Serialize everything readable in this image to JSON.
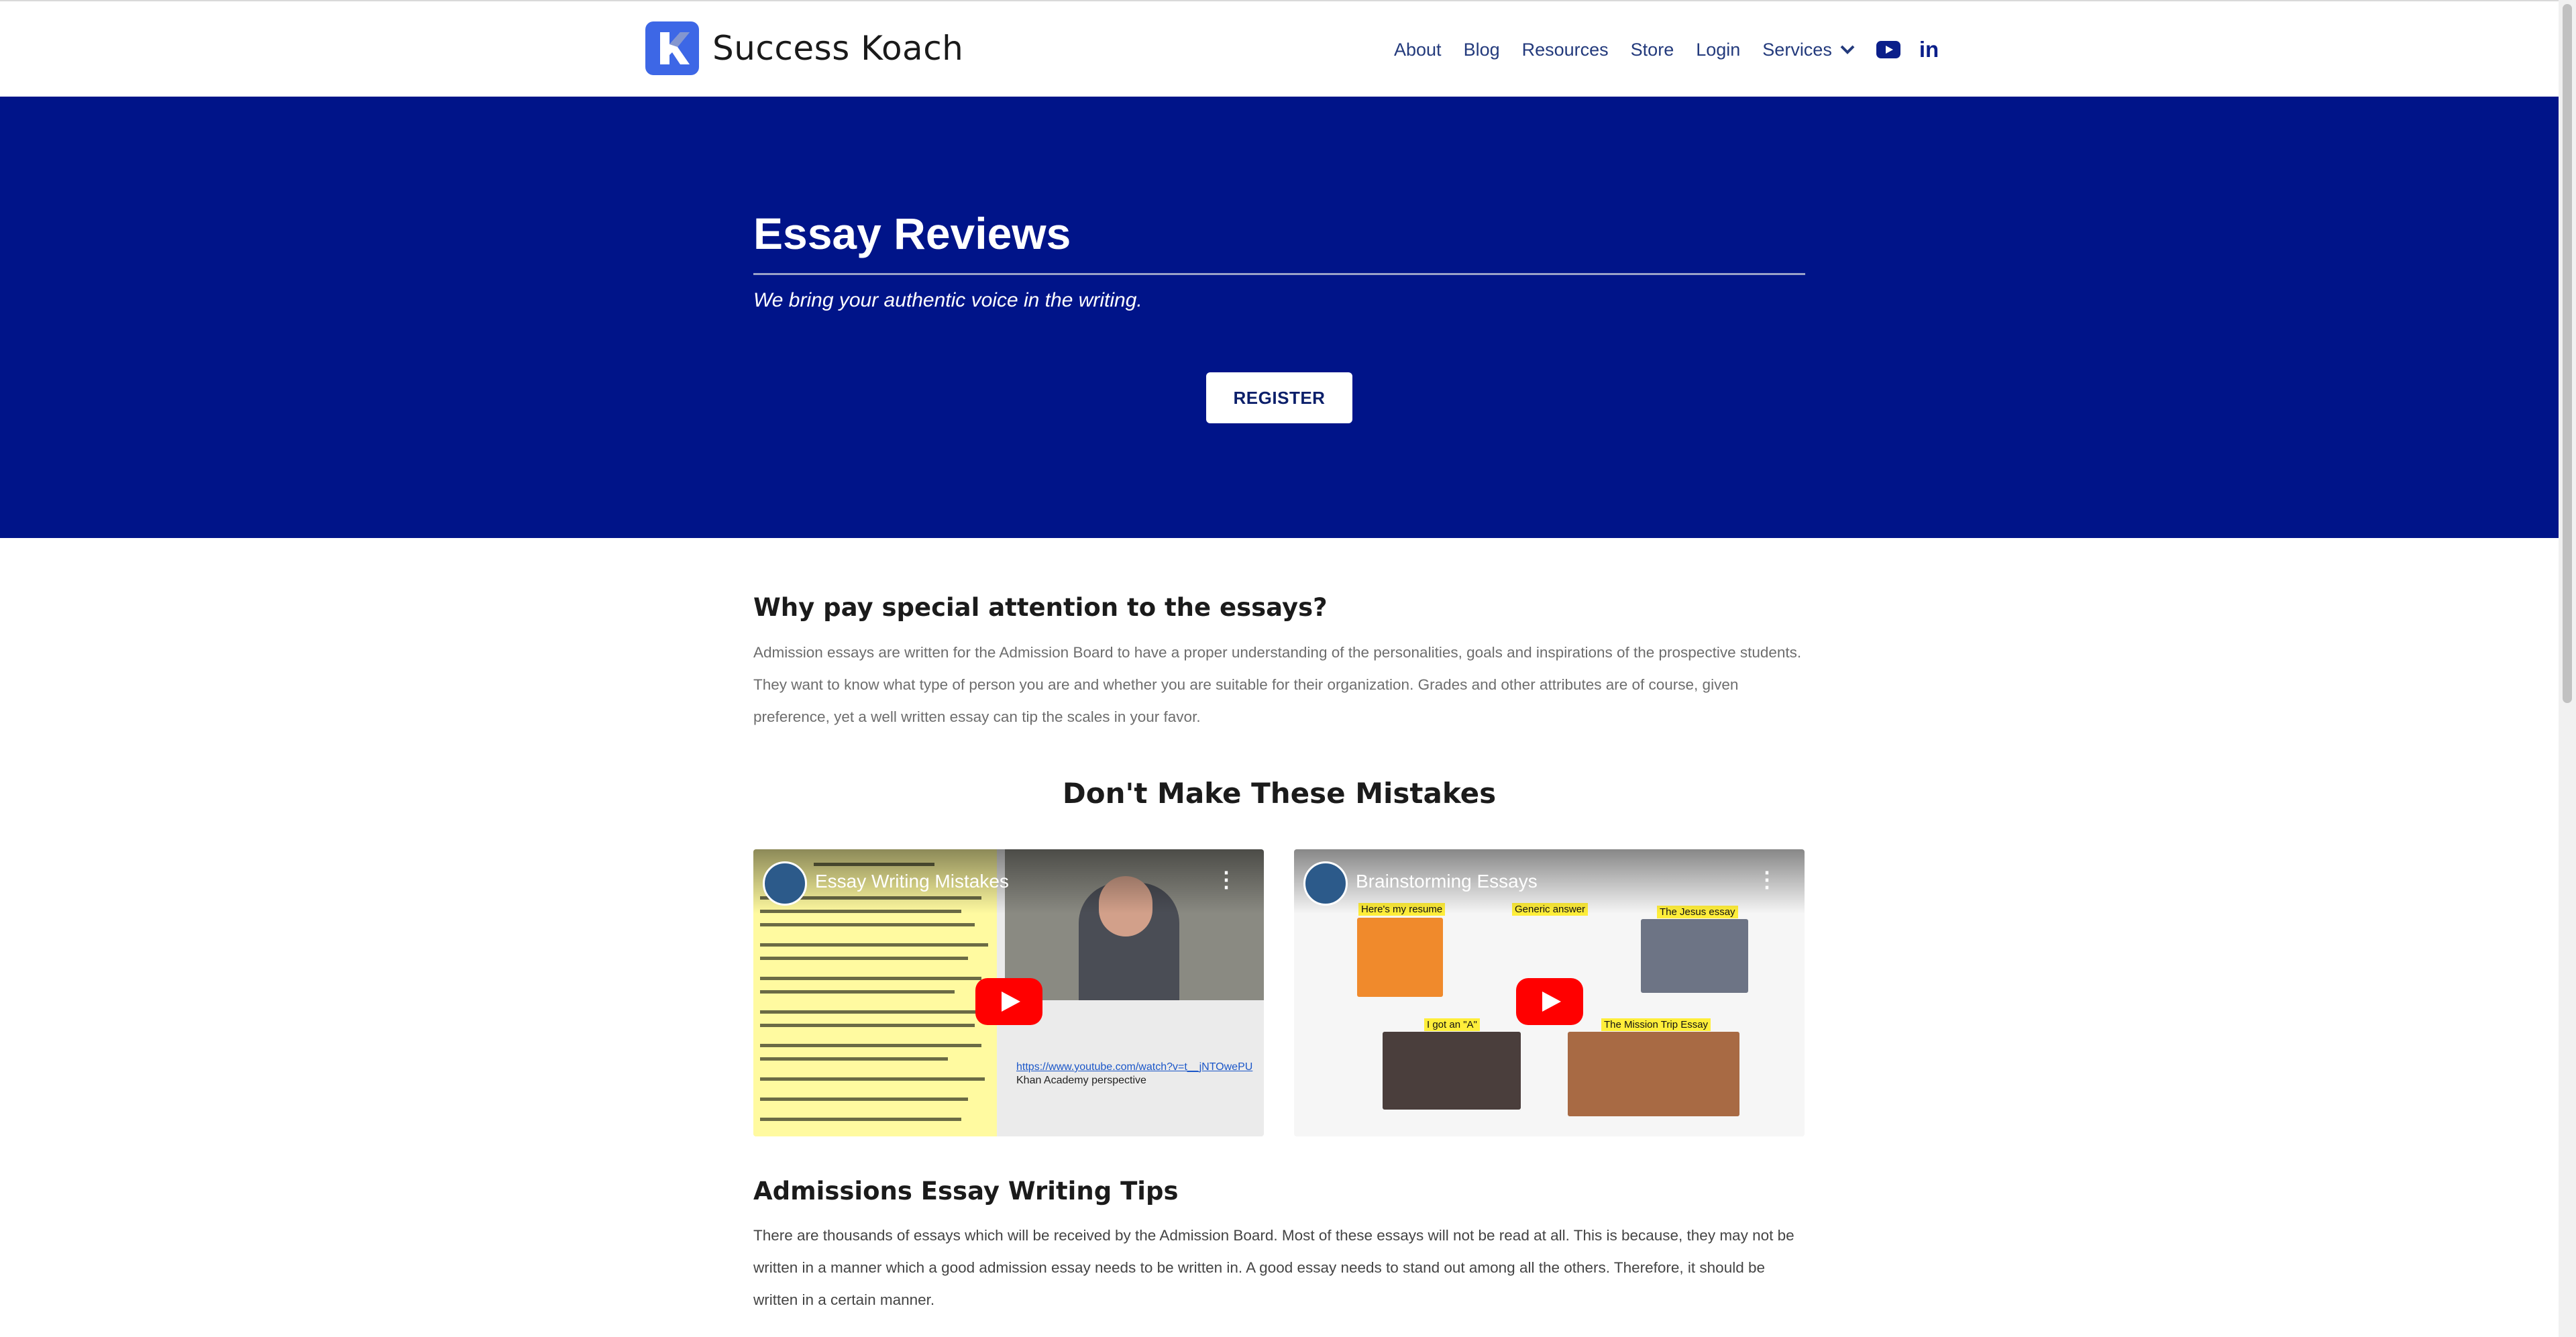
{
  "brand": {
    "name": "Success Koach"
  },
  "nav": {
    "items": [
      "About",
      "Blog",
      "Resources",
      "Store",
      "Login"
    ],
    "services_label": "Services",
    "social": [
      "youtube-icon",
      "linkedin-icon"
    ]
  },
  "hero": {
    "title": "Essay Reviews",
    "tagline": "We bring your authentic voice in the writing.",
    "button": "REGISTER",
    "background_color": "#001489"
  },
  "section_why": {
    "heading": "Why pay special attention to the essays?",
    "body": "Admission essays are written for the Admission Board to have a proper understanding of the personalities, goals and inspirations of the prospective students. They want to know what type of person you are and whether you are suitable for their organization. Grades and other attributes are of course, given preference, yet a well written essay can tip the scales in your favor."
  },
  "section_mistakes": {
    "heading": "Don't Make These Mistakes",
    "videos": [
      {
        "title": "Essay Writing Mistakes",
        "link_text": "https://www.youtube.com/watch?v=t__jNTOwePU",
        "link_caption": "Khan Academy perspective"
      },
      {
        "title": "Brainstorming Essays",
        "labels": [
          "Here's my resume",
          "Generic answer",
          "The Jesus essay",
          "I got an \"A\"",
          "The Mission Trip Essay"
        ]
      }
    ]
  },
  "section_tips": {
    "heading": "Admissions Essay Writing Tips",
    "body": "There are thousands of essays which will be received by the Admission Board. Most of these essays will not be read at all. This is because, they may not be written in a manner which a good admission essay needs to be written in. A good essay needs to stand out among all the others. Therefore, it should be written in a certain manner."
  }
}
